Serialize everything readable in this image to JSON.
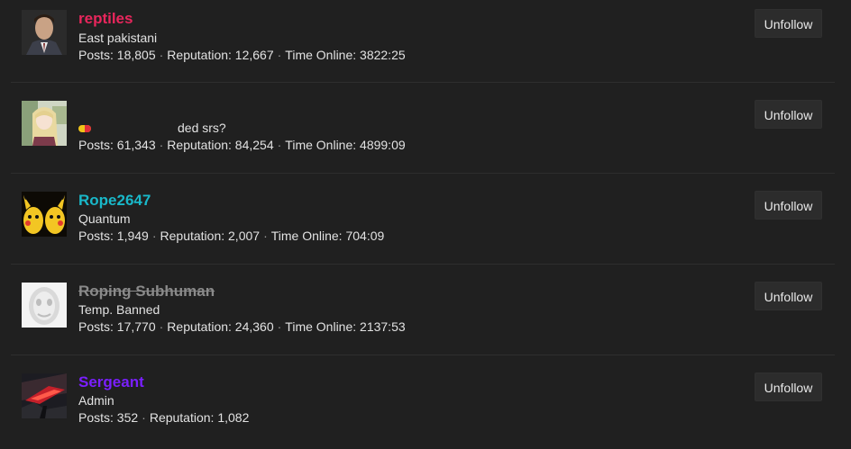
{
  "users": [
    {
      "name": "reptiles",
      "name_color": "#e8265c",
      "subtitle": "East pakistani",
      "posts_label": "Posts:",
      "posts": "18,805",
      "rep_label": "Reputation:",
      "rep": "12,667",
      "online_label": "Time Online:",
      "online": "3822:25",
      "button": "Unfollow"
    },
    {
      "name": "",
      "subtitle": "ded srs?",
      "posts_label": "Posts:",
      "posts": "61,343",
      "rep_label": "Reputation:",
      "rep": "84,254",
      "online_label": "Time Online:",
      "online": "4899:09",
      "button": "Unfollow"
    },
    {
      "name": "Rope2647",
      "name_color": "#19b8c9",
      "subtitle": "Quantum",
      "posts_label": "Posts:",
      "posts": "1,949",
      "rep_label": "Reputation:",
      "rep": "2,007",
      "online_label": "Time Online:",
      "online": "704:09",
      "button": "Unfollow"
    },
    {
      "name": "Roping Subhuman",
      "name_color": "#8a8a8a",
      "subtitle": "Temp. Banned",
      "posts_label": "Posts:",
      "posts": "17,770",
      "rep_label": "Reputation:",
      "rep": "24,360",
      "online_label": "Time Online:",
      "online": "2137:53",
      "button": "Unfollow"
    },
    {
      "name": "Sergeant",
      "name_color": "#7a1fff",
      "subtitle": "Admin",
      "posts_label": "Posts:",
      "posts": "352",
      "rep_label": "Reputation:",
      "rep": "1,082",
      "button": "Unfollow"
    }
  ],
  "separator": "·"
}
